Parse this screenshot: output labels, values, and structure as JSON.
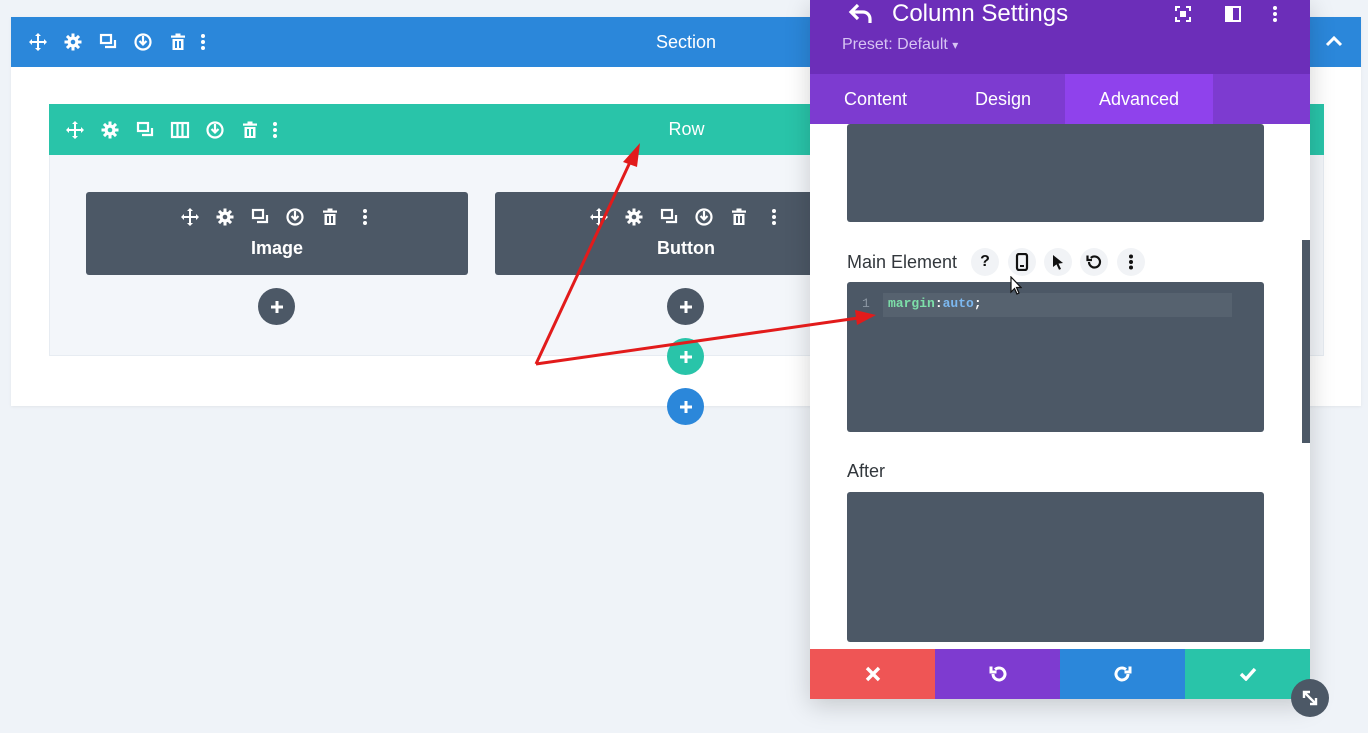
{
  "section": {
    "title": "Section",
    "color": "#2b87da"
  },
  "row": {
    "title": "Row",
    "color": "#29c4a9"
  },
  "modules": [
    {
      "label": "Image"
    },
    {
      "label": "Button"
    }
  ],
  "panel": {
    "title": "Column Settings",
    "preset": "Preset: Default",
    "preset_caret": "▾",
    "tabs": [
      {
        "label": "Content",
        "active": false
      },
      {
        "label": "Design",
        "active": false
      },
      {
        "label": "Advanced",
        "active": true
      }
    ],
    "main_element_label": "Main Element",
    "help_glyph": "?",
    "after_label": "After",
    "code": {
      "line_number": "1",
      "property": "margin",
      "colon": ":",
      "value": "auto",
      "semicolon": ";"
    },
    "footer": {
      "cancel_color": "#ef5555",
      "undo_color": "#7e3bd0",
      "redo_color": "#2b87da",
      "save_color": "#29c4a9"
    }
  },
  "colors": {
    "header_purple": "#6c2eb9",
    "tab_bar": "#7d3bd0",
    "tab_active": "#8f42ec",
    "module_dark": "#4c5866",
    "annotation_red": "#e21b1b"
  },
  "icons": [
    "move-icon",
    "gear-icon",
    "duplicate-icon",
    "columns-icon",
    "save-to-library-icon",
    "trash-icon",
    "more-dots-icon",
    "plus-icon",
    "back-arrow-icon",
    "fullscreen-icon",
    "sidebar-icon",
    "phone-icon",
    "cursor-icon",
    "reset-icon",
    "close-icon",
    "undo-icon",
    "redo-icon",
    "check-icon",
    "resize-icon"
  ]
}
